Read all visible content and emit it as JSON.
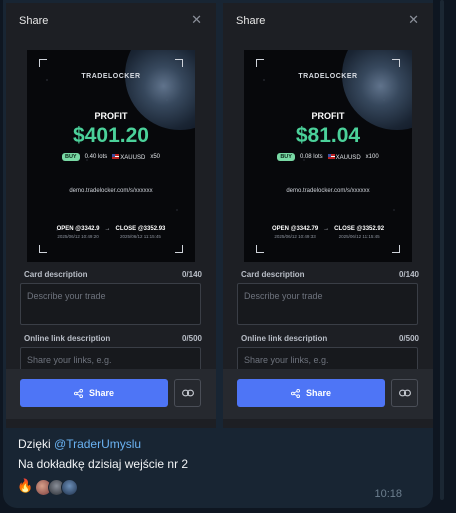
{
  "share_panels": [
    {
      "title": "Share",
      "card": {
        "logo": "TRADELOCKER",
        "profit_label": "PROFIT",
        "profit_value": "$401.20",
        "side": "BUY",
        "lots": "0.40 lots",
        "symbol": "XAUUSD",
        "leverage": "x50",
        "link": "demo.tradelocker.com/s/xxxxxx",
        "open": "OPEN @3342.9",
        "open_date": "2025/06/12 10:49:20",
        "close": "CLOSE @3352.93",
        "close_date": "2025/06/12 11:15:45"
      },
      "card_description_label": "Card description",
      "card_description_count": "0/140",
      "card_description_placeholder": "Describe your trade",
      "online_link_label": "Online link description",
      "online_link_count": "0/500",
      "online_link_placeholder": "Share your links, e.g.",
      "share_button": "Share"
    },
    {
      "title": "Share",
      "card": {
        "logo": "TRADELOCKER",
        "profit_label": "PROFIT",
        "profit_value": "$81.04",
        "side": "BUY",
        "lots": "0.08 lots",
        "symbol": "XAUUSD",
        "leverage": "x100",
        "link": "demo.tradelocker.com/s/xxxxxx",
        "open": "OPEN @3342.79",
        "open_date": "2025/06/12 10:49:33",
        "close": "CLOSE @3352.92",
        "close_date": "2025/06/12 11:15:45"
      },
      "card_description_label": "Card description",
      "card_description_count": "0/140",
      "card_description_placeholder": "Describe your trade",
      "online_link_label": "Online link description",
      "online_link_count": "0/500",
      "online_link_placeholder": "Share your links, e.g.",
      "share_button": "Share"
    }
  ],
  "message": {
    "line1_prefix": "Dzięki ",
    "mention": "@TraderUmyslu",
    "line2": "Na dokładkę dzisiaj wejście nr 2",
    "reaction_emoji": "🔥",
    "time": "10:18"
  },
  "colors": {
    "bubble": "#182533",
    "profit_green": "#4bd19a",
    "share_button": "#4e75f6",
    "mention": "#6ab2f2"
  }
}
